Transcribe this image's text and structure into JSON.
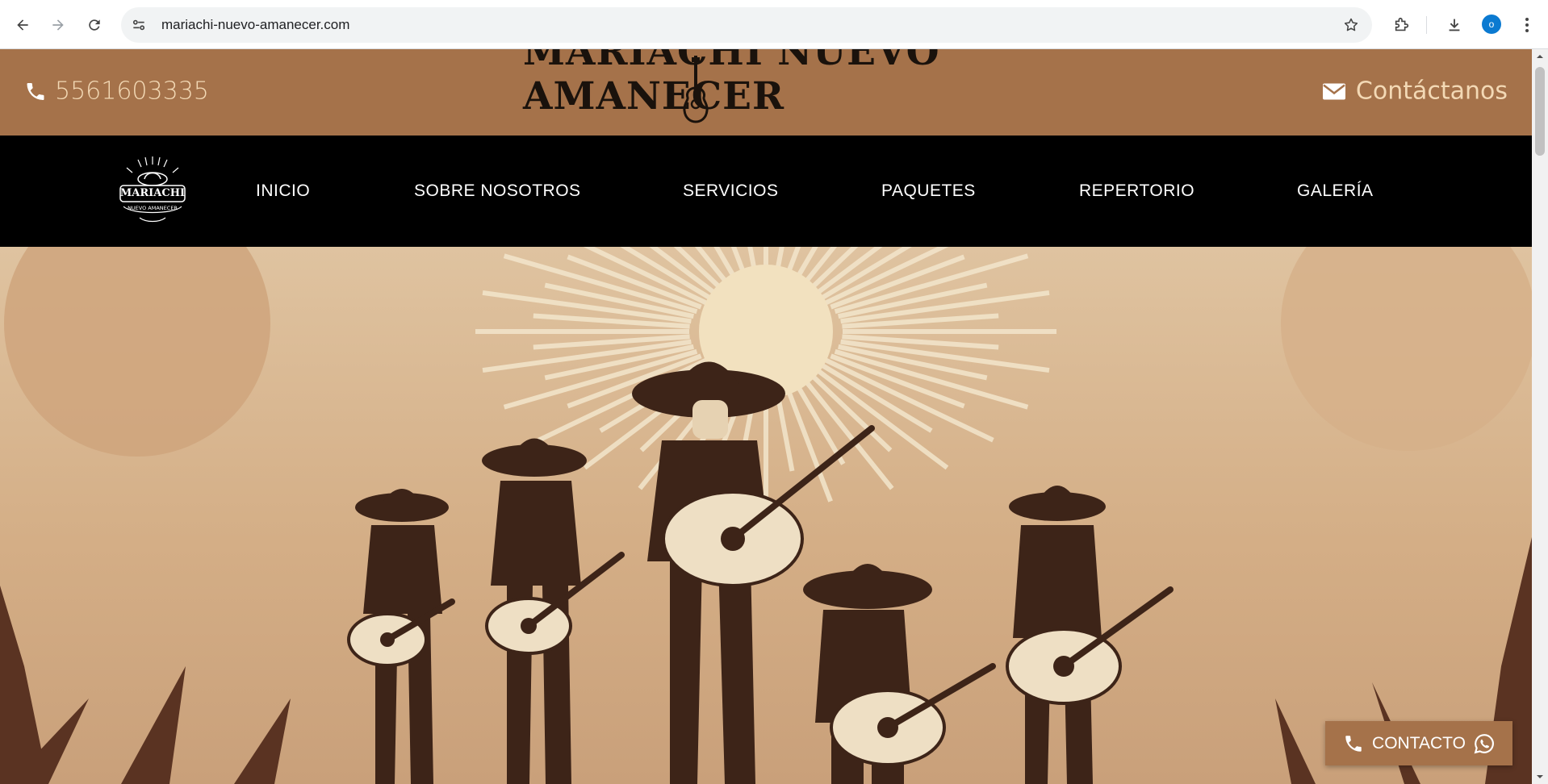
{
  "browser": {
    "url": "mariachi-nuevo-amanecer.com",
    "avatar_letter": "o",
    "icons": [
      "back-icon",
      "forward-icon",
      "reload-icon",
      "site-info-icon",
      "star-icon",
      "extensions-icon",
      "download-icon",
      "menu-icon"
    ]
  },
  "header": {
    "phone": "5561603335",
    "brand_title": "MARIACHI NUEVO AMANECER",
    "contact": "Contáctanos"
  },
  "nav": {
    "logo_text": "MARIACHI",
    "logo_subtext": "NUEVO AMANECER",
    "items": [
      {
        "label": "INICIO"
      },
      {
        "label": "SOBRE NOSOTROS"
      },
      {
        "label": "SERVICIOS"
      },
      {
        "label": "PAQUETES"
      },
      {
        "label": "REPERTORIO"
      },
      {
        "label": "GALERÍA"
      }
    ]
  },
  "floating_contact": {
    "label": "CONTACTO"
  },
  "colors": {
    "brand_brown": "#a5724a",
    "nav_black": "#000000",
    "header_text": "#f3d9b5",
    "hero_sepia": "#d4ae86"
  }
}
